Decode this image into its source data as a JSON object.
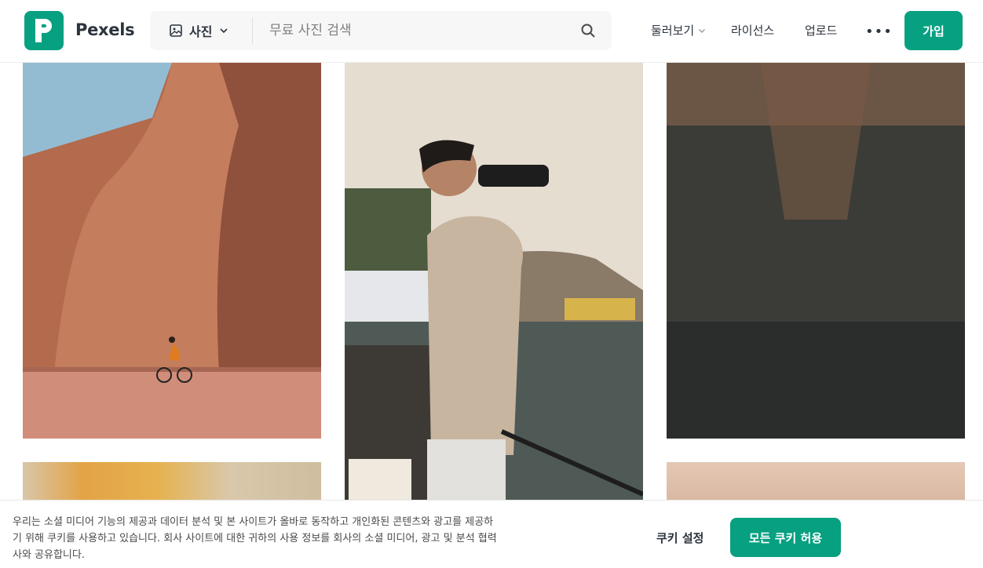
{
  "header": {
    "brand": "Pexels",
    "media_type": "사진",
    "search_placeholder": "무료 사진 검색",
    "nav": {
      "explore": "둘러보기",
      "license": "라이선스",
      "upload": "업로드",
      "more": "•••",
      "join": "가입"
    }
  },
  "colors": {
    "brand_green": "#07a081"
  },
  "cookie_banner": {
    "text": "우리는 소셜 미디어 기능의 제공과 데이터 분석 및 본 사이트가 올바로 동작하고 개인화된 콘텐츠와 광고를 제공하기 위해 쿠키를 사용하고 있습니다. 회사 사이트에 대한 귀하의 사용 정보를 회사의 소셜 미디어, 광고 및 분석 협력사와 공유합니다.",
    "settings_label": "쿠키 설정",
    "accept_label": "모든 쿠키 허용"
  }
}
